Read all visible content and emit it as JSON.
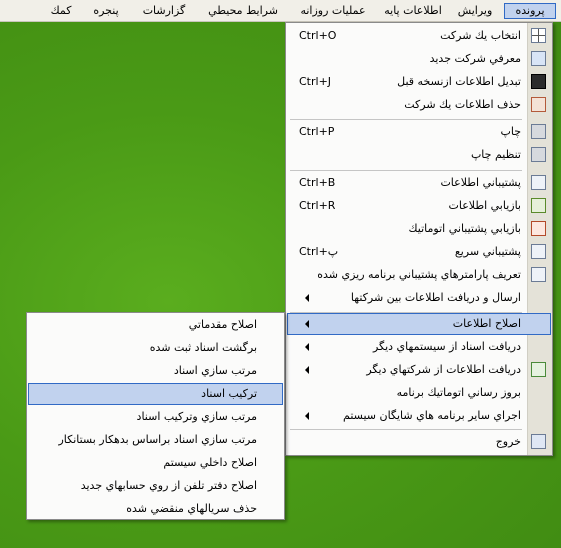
{
  "menubar": {
    "items": [
      "پرونده",
      "ويرايش",
      "اطلاعات پايه",
      "عمليات روزانه",
      "شرايط محيطي",
      "گزارشات",
      "پنجره",
      "كمك"
    ]
  },
  "file_menu": {
    "items": [
      {
        "label": "انتخاب يك شركت",
        "shortcut": "Ctrl+O",
        "icon": "grid-icon"
      },
      {
        "label": "معرفي شركت جديد",
        "shortcut": "",
        "icon": "company-icon"
      },
      {
        "label": "تبديل اطلاعات ازنسخه قبل",
        "shortcut": "Ctrl+J",
        "icon": "convert-icon"
      },
      {
        "label": "حذف اطلاعات يك شركت",
        "shortcut": "",
        "icon": "delete-company-icon"
      },
      {
        "label": "چاپ",
        "shortcut": "Ctrl+P",
        "icon": "printer-icon"
      },
      {
        "label": "تنظيم چاپ",
        "shortcut": "",
        "icon": "print-setup-icon"
      },
      {
        "label": "پشتيباني اطلاعات",
        "shortcut": "Ctrl+B",
        "icon": "backup-icon"
      },
      {
        "label": "بازيابي اطلاعات",
        "shortcut": "Ctrl+R",
        "icon": "restore-icon"
      },
      {
        "label": "بازيابي پشتيباني اتوماتيك",
        "shortcut": "",
        "icon": "auto-restore-icon"
      },
      {
        "label": "پشتيباني سريع",
        "shortcut": "Ctrl+پ",
        "icon": "quick-backup-icon"
      },
      {
        "label": "تعريف پارامترهاي پشتيباني برنامه ريزي شده",
        "shortcut": "",
        "icon": "schedule-icon"
      },
      {
        "label": "ارسال و دريافت اطلاعات بين شركتها",
        "shortcut": "",
        "icon": ""
      },
      {
        "label": "اصلاح اطلاعات",
        "shortcut": "",
        "icon": ""
      },
      {
        "label": "دريافت اسناد از سيستمهاي ديگر",
        "shortcut": "",
        "icon": ""
      },
      {
        "label": "دريافت اطلاعات از شركتهاي ديگر",
        "shortcut": "",
        "icon": "import-icon"
      },
      {
        "label": "بروز رساني اتوماتيك برنامه",
        "shortcut": "",
        "icon": ""
      },
      {
        "label": "اجراي ساير برنامه هاي شايگان سيستم",
        "shortcut": "",
        "icon": ""
      },
      {
        "label": "خروج",
        "shortcut": "",
        "icon": "exit-icon"
      }
    ]
  },
  "repair_submenu": {
    "items": [
      "اصلاح مقدماتي",
      "برگشت اسناد ثبت شده",
      "مرتب سازي اسناد",
      "تركيب اسناد",
      "مرتب سازي وتركيب اسناد",
      "مرتب سازي اسناد براساس بدهكار بستانكار",
      "اصلاح داخلي سيستم",
      "اصلاح دفتر تلفن از روي حسابهاي جديد",
      "حذف سريالهاي منقضي شده"
    ]
  }
}
